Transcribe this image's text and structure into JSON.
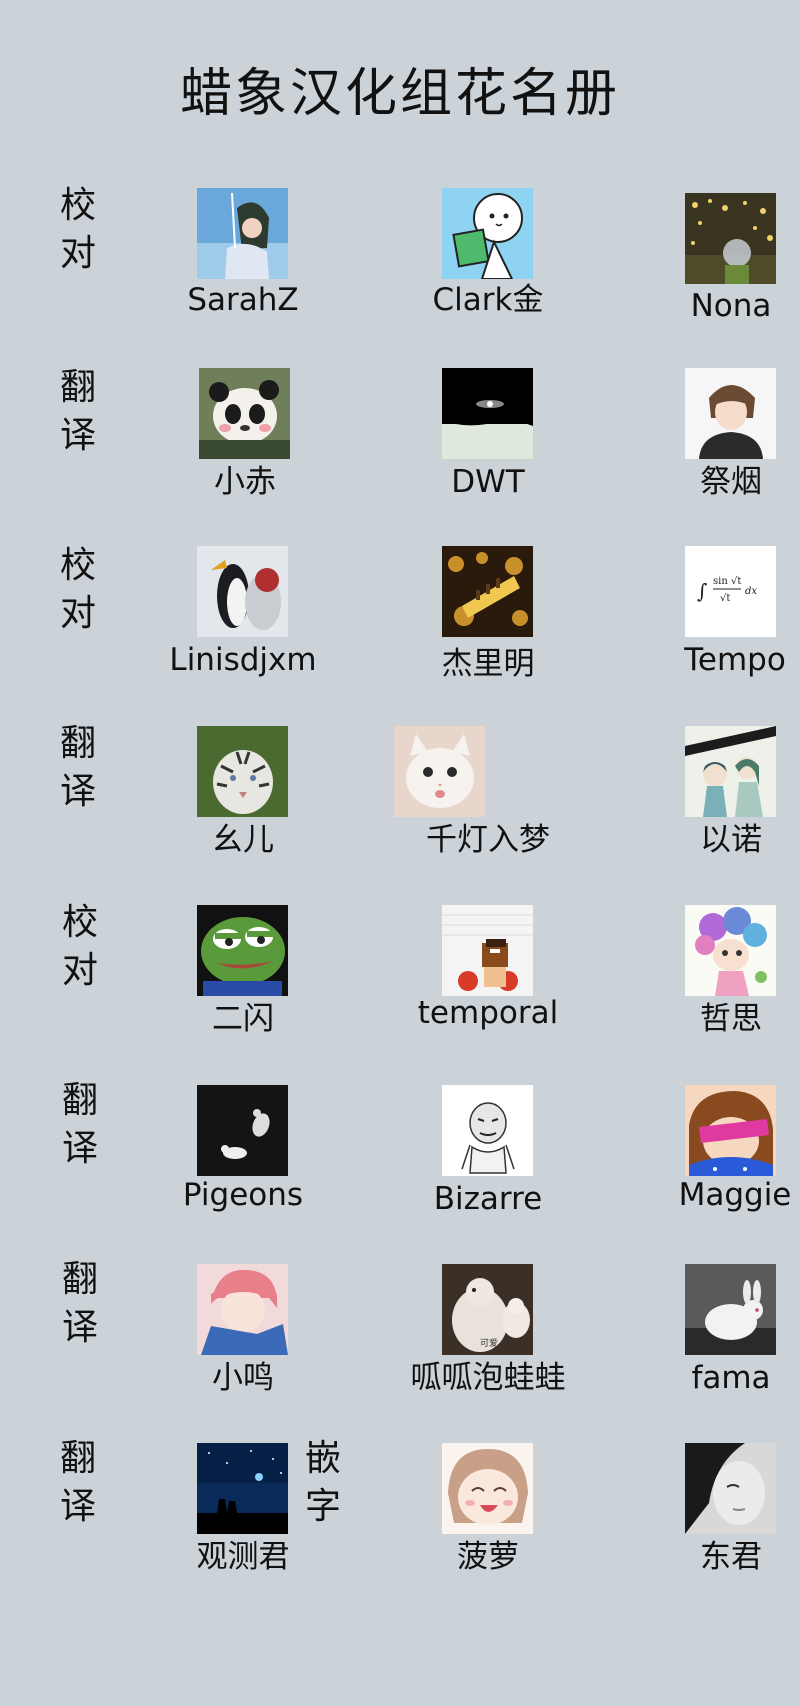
{
  "title": "蜡象汉化组花名册",
  "rows": [
    {
      "role": [
        "校",
        "对"
      ],
      "members": [
        {
          "name": "SarahZ",
          "avatar": "anime-girl-sky-icon"
        },
        {
          "name": "Clark金",
          "avatar": "cartoon-reading-book-icon"
        },
        {
          "name": "Nona",
          "avatar": "glass-ball-lights-icon"
        }
      ]
    },
    {
      "role": [
        "翻",
        "译"
      ],
      "members": [
        {
          "name": "小赤",
          "avatar": "panda-icon"
        },
        {
          "name": "DWT",
          "avatar": "galaxy-icon"
        },
        {
          "name": "祭烟",
          "avatar": "anime-boy-icon"
        }
      ]
    },
    {
      "role": [
        "校",
        "对"
      ],
      "members": [
        {
          "name": "Linisdjxm",
          "avatar": "penguin-icon"
        },
        {
          "name": "杰里明",
          "avatar": "gold-items-icon"
        },
        {
          "name": "Tempo",
          "avatar": "integral-formula-icon"
        }
      ]
    },
    {
      "role": [
        "翻",
        "译"
      ],
      "members": [
        {
          "name": "幺儿",
          "avatar": "white-tiger-icon"
        },
        {
          "name": "千灯入梦",
          "avatar": "white-cat-icon"
        },
        {
          "name": "以诺",
          "avatar": "anime-couple-icon"
        }
      ]
    },
    {
      "role": [
        "校",
        "对"
      ],
      "members": [
        {
          "name": "二闪",
          "avatar": "pepe-frog-icon"
        },
        {
          "name": "temporal",
          "avatar": "pixel-boxer-icon"
        },
        {
          "name": "哲思",
          "avatar": "colorful-girl-drawing-icon"
        }
      ]
    },
    {
      "role": [
        "翻",
        "译"
      ],
      "members": [
        {
          "name": "Pigeons",
          "avatar": "white-pigeons-icon"
        },
        {
          "name": "Bizarre",
          "avatar": "meme-sketch-icon"
        },
        {
          "name": "Maggie",
          "avatar": "cartoon-girl-visor-icon"
        }
      ]
    },
    {
      "role": [
        "翻",
        "译"
      ],
      "members": [
        {
          "name": "小鸣",
          "avatar": "pink-hair-boy-icon"
        },
        {
          "name": "呱呱泡蛙蛙",
          "avatar": "dove-pair-icon",
          "caption": "可爱"
        },
        {
          "name": "fama",
          "avatar": "white-rabbit-icon"
        }
      ]
    },
    {
      "role": [
        "翻",
        "译"
      ],
      "role2": [
        "嵌",
        "字"
      ],
      "members": [
        {
          "name": "观测君",
          "avatar": "night-sky-couple-icon"
        },
        {
          "name": "菠萝",
          "avatar": "laughing-anime-girl-icon"
        },
        {
          "name": "东君",
          "avatar": "woman-portrait-icon"
        }
      ]
    }
  ]
}
